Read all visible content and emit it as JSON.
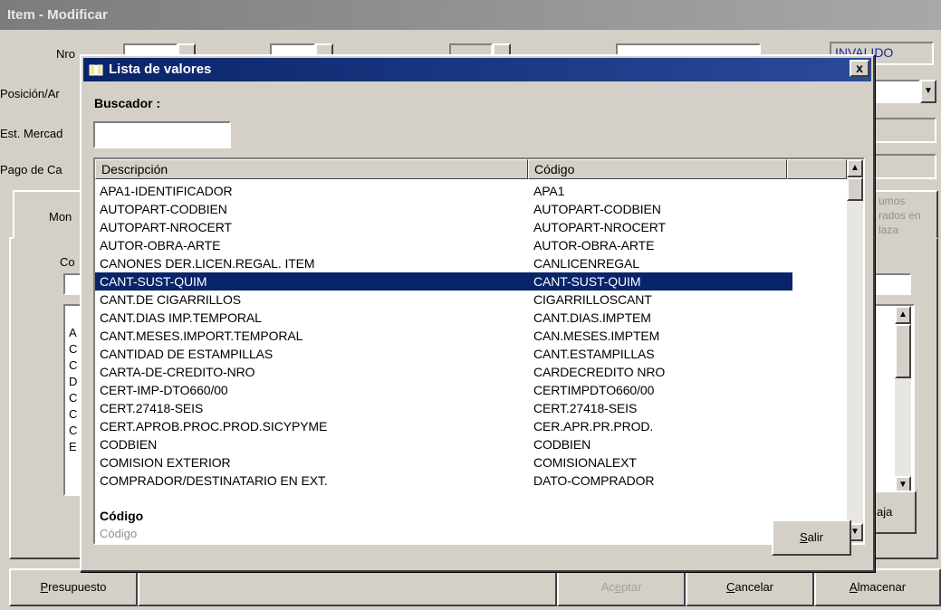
{
  "window": {
    "title": "Item - Modificar",
    "labels": {
      "nro": "Nro",
      "posicion": "Posición/Ar",
      "est_mercad": "Est. Mercad",
      "pago": "Pago de Ca",
      "mon": "Mon",
      "co": "Co",
      "estado_value": "INVALIDO",
      "right_tab": "umos rados en laza",
      "right_btn": "aja"
    },
    "list_left_letters": [
      "A",
      "C",
      "C",
      "D",
      "C",
      "C",
      "C",
      "E"
    ],
    "buttons": {
      "presupuesto": "Presupuesto",
      "aceptar": "Aceptar",
      "cancelar": "Cancelar",
      "almacenar": "Almacenar"
    }
  },
  "dialog": {
    "title": "Lista de valores",
    "close": "x",
    "search": {
      "label": "Buscador :",
      "value": ""
    },
    "columns": [
      "Descripción",
      "Código"
    ],
    "rows": [
      {
        "desc": "APA1-IDENTIFICADOR",
        "code": "APA1"
      },
      {
        "desc": "AUTOPART-CODBIEN",
        "code": "AUTOPART-CODBIEN"
      },
      {
        "desc": "AUTOPART-NROCERT",
        "code": "AUTOPART-NROCERT"
      },
      {
        "desc": "AUTOR-OBRA-ARTE",
        "code": "AUTOR-OBRA-ARTE"
      },
      {
        "desc": "CANONES DER.LICEN.REGAL. ITEM",
        "code": "CANLICENREGAL"
      },
      {
        "desc": "CANT-SUST-QUIM",
        "code": "CANT-SUST-QUIM"
      },
      {
        "desc": "CANT.DE CIGARRILLOS",
        "code": "CIGARRILLOSCANT"
      },
      {
        "desc": "CANT.DIAS IMP.TEMPORAL",
        "code": "CANT.DIAS.IMPTEM"
      },
      {
        "desc": "CANT.MESES.IMPORT.TEMPORAL",
        "code": "CAN.MESES.IMPTEM"
      },
      {
        "desc": "CANTIDAD DE ESTAMPILLAS",
        "code": "CANT.ESTAMPILLAS"
      },
      {
        "desc": "CARTA-DE-CREDITO-NRO",
        "code": "CARDECREDITO NRO"
      },
      {
        "desc": "CERT-IMP-DTO660/00",
        "code": "CERTIMPDTO660/00"
      },
      {
        "desc": "CERT.27418-SEIS",
        "code": "CERT.27418-SEIS"
      },
      {
        "desc": "CERT.APROB.PROC.PROD.SICYPYME",
        "code": "CER.APR.PR.PROD."
      },
      {
        "desc": "CODBIEN",
        "code": "CODBIEN"
      },
      {
        "desc": "COMISION EXTERIOR",
        "code": "COMISIONALEXT"
      },
      {
        "desc": "COMPRADOR/DESTINATARIO EN EXT.",
        "code": "DATO-COMPRADOR"
      }
    ],
    "selected_index": 5,
    "field_name": "Código",
    "field_hint": "Código",
    "exit_button": "Salir",
    "scroll_up": "▲",
    "scroll_down": "▼"
  }
}
